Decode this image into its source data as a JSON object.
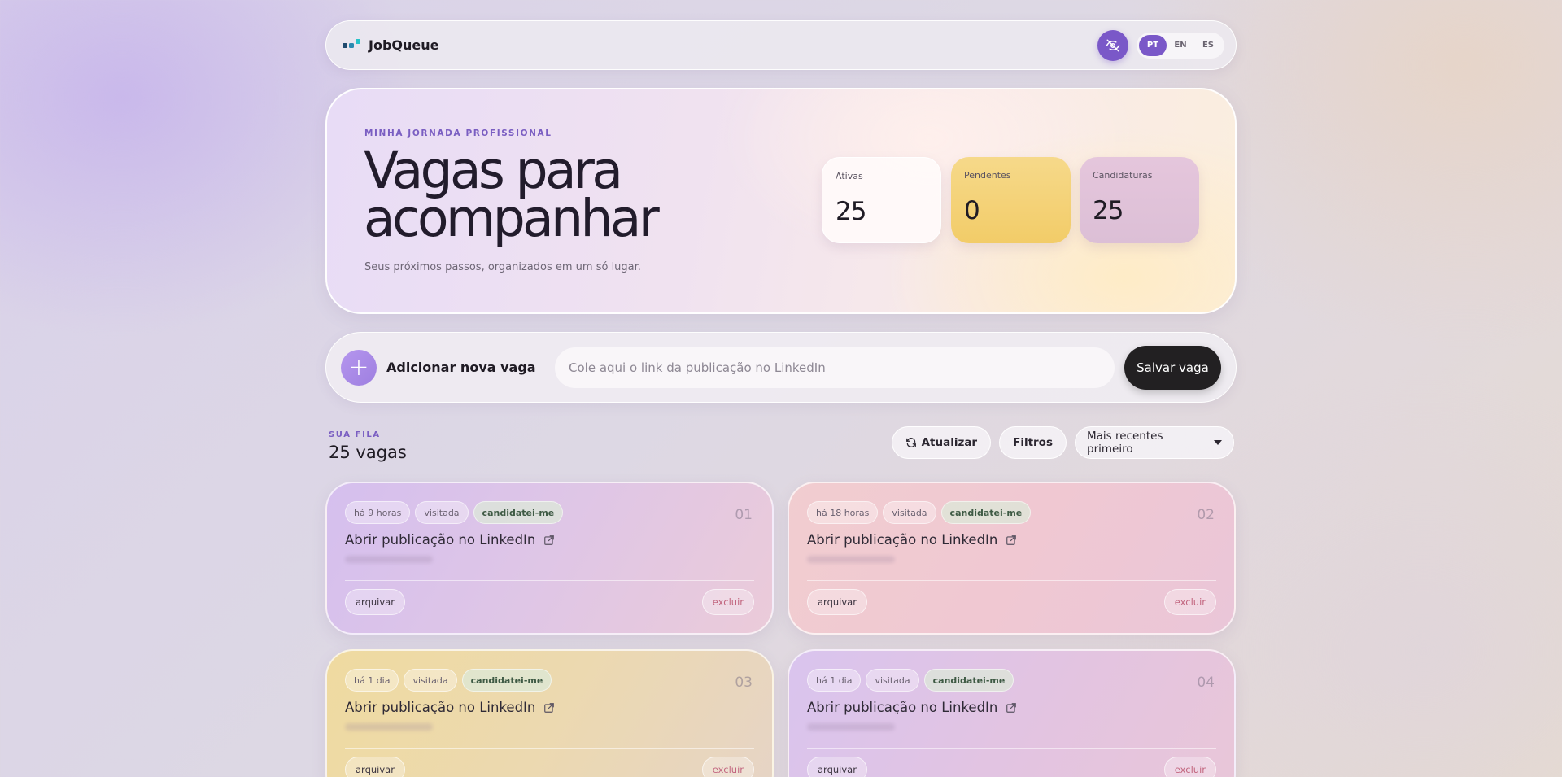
{
  "brand": {
    "name": "JobQueue",
    "logo_colors": [
      "#1f4a6e",
      "#2a8ab0",
      "#25c2c8"
    ]
  },
  "header": {
    "visibility_icon": "eye-off-icon",
    "languages": [
      "PT",
      "EN",
      "ES"
    ],
    "active_language": "PT",
    "accent": "#7a58c8"
  },
  "hero": {
    "eyebrow": "MINHA JORNADA PROFISSIONAL",
    "title": "Vagas para acompanhar",
    "subtitle": "Seus próximos passos, organizados em um só lugar.",
    "stats": [
      {
        "label": "Ativas",
        "value": "25"
      },
      {
        "label": "Pendentes",
        "value": "0"
      },
      {
        "label": "Candidaturas",
        "value": "25"
      }
    ]
  },
  "add": {
    "label": "Adicionar nova vaga",
    "placeholder": "Cole aqui o link da publicação no LinkedIn",
    "value": "",
    "save_label": "Salvar vaga"
  },
  "queue": {
    "eyebrow": "SUA FILA",
    "count_label": "25 vagas",
    "refresh_label": "Atualizar",
    "filters_label": "Filtros",
    "sort_value": "Mais recentes primeiro"
  },
  "cards": [
    {
      "time": "há 9 horas",
      "visited": "visitada",
      "status": "candidatei-me",
      "index": "01",
      "link": "Abrir publicação no LinkedIn",
      "archive": "arquivar",
      "delete": "excluir",
      "theme": "purple"
    },
    {
      "time": "há 18 horas",
      "visited": "visitada",
      "status": "candidatei-me",
      "index": "02",
      "link": "Abrir publicação no LinkedIn",
      "archive": "arquivar",
      "delete": "excluir",
      "theme": "pink"
    },
    {
      "time": "há 1 dia",
      "visited": "visitada",
      "status": "candidatei-me",
      "index": "03",
      "link": "Abrir publicação no LinkedIn",
      "archive": "arquivar",
      "delete": "excluir",
      "theme": "yellow"
    },
    {
      "time": "há 1 dia",
      "visited": "visitada",
      "status": "candidatei-me",
      "index": "04",
      "link": "Abrir publicação no LinkedIn",
      "archive": "arquivar",
      "delete": "excluir",
      "theme": "lilac"
    }
  ]
}
